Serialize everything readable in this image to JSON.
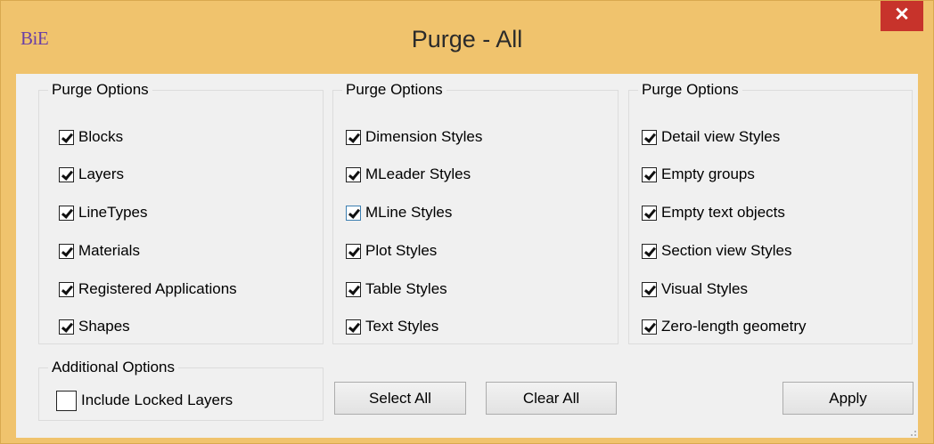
{
  "window": {
    "logo": "BiE",
    "title": "Purge - All",
    "close_symbol": "✕"
  },
  "groups": [
    {
      "label": "Purge Options",
      "items": [
        {
          "label": "Blocks",
          "checked": true
        },
        {
          "label": "Layers",
          "checked": true
        },
        {
          "label": "LineTypes",
          "checked": true
        },
        {
          "label": "Materials",
          "checked": true
        },
        {
          "label": "Registered Applications",
          "checked": true
        },
        {
          "label": "Shapes",
          "checked": true
        }
      ]
    },
    {
      "label": "Purge Options",
      "items": [
        {
          "label": "Dimension Styles",
          "checked": true
        },
        {
          "label": "MLeader Styles",
          "checked": true
        },
        {
          "label": "MLine Styles",
          "checked": true,
          "focused": true
        },
        {
          "label": "Plot Styles",
          "checked": true
        },
        {
          "label": "Table Styles",
          "checked": true
        },
        {
          "label": "Text Styles",
          "checked": true
        }
      ]
    },
    {
      "label": "Purge Options",
      "items": [
        {
          "label": "Detail view Styles",
          "checked": true
        },
        {
          "label": "Empty groups",
          "checked": true
        },
        {
          "label": "Empty text objects",
          "checked": true
        },
        {
          "label": "Section view Styles",
          "checked": true
        },
        {
          "label": "Visual Styles",
          "checked": true
        },
        {
          "label": "Zero-length geometry",
          "checked": true
        }
      ]
    }
  ],
  "additional": {
    "label": "Additional Options",
    "include_locked_layers": {
      "label": "Include Locked Layers",
      "checked": false
    }
  },
  "buttons": {
    "select_all": "Select All",
    "clear_all": "Clear All",
    "apply": "Apply"
  },
  "colors": {
    "frame": "#f0c36d",
    "close": "#c7332b",
    "logo": "#6a3fa6"
  }
}
